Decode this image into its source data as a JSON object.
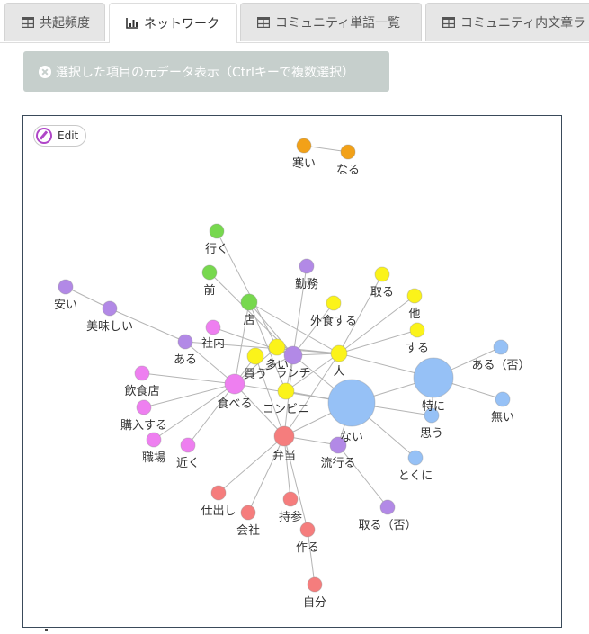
{
  "tabs": [
    {
      "label": "共起頻度",
      "icon": "table-icon",
      "active": false
    },
    {
      "label": "ネットワーク",
      "icon": "bar-chart-icon",
      "active": true
    },
    {
      "label": "コミュニティ単語一覧",
      "icon": "table-icon",
      "active": false
    },
    {
      "label": "コミュニティ内文章ラ",
      "icon": "table-icon",
      "active": false
    }
  ],
  "toolbar": {
    "show_source_label": "選択した項目の元データ表示（Ctrlキーで複数選択）",
    "show_source_icon": "close-circle-icon"
  },
  "network": {
    "edit_label": "Edit",
    "edit_icon": "pencil-circle-icon",
    "colors": {
      "orange": "#f2a118",
      "green": "#77d84e",
      "purple": "#b289e6",
      "pink": "#ee7ff0",
      "yellow": "#fbf31a",
      "blue": "#96c1f6",
      "red": "#f57d7d",
      "edge": "#b4b4b4"
    },
    "nodes": [
      {
        "label": "寒い",
        "color": "orange"
      },
      {
        "label": "なる",
        "color": "orange"
      },
      {
        "label": "行く",
        "color": "green"
      },
      {
        "label": "前",
        "color": "green"
      },
      {
        "label": "店",
        "color": "green"
      },
      {
        "label": "安い",
        "color": "purple"
      },
      {
        "label": "美味しい",
        "color": "purple"
      },
      {
        "label": "ある",
        "color": "purple"
      },
      {
        "label": "勤務",
        "color": "purple"
      },
      {
        "label": "ランチ",
        "color": "purple"
      },
      {
        "label": "流行る",
        "color": "purple"
      },
      {
        "label": "取る（否）",
        "color": "purple"
      },
      {
        "label": "社内",
        "color": "pink"
      },
      {
        "label": "飲食店",
        "color": "pink"
      },
      {
        "label": "食べる",
        "color": "pink"
      },
      {
        "label": "購入する",
        "color": "pink"
      },
      {
        "label": "職場",
        "color": "pink"
      },
      {
        "label": "近く",
        "color": "pink"
      },
      {
        "label": "取る",
        "color": "yellow"
      },
      {
        "label": "他",
        "color": "yellow"
      },
      {
        "label": "外食する",
        "color": "yellow"
      },
      {
        "label": "する",
        "color": "yellow"
      },
      {
        "label": "買う",
        "color": "yellow"
      },
      {
        "label": "多い",
        "color": "yellow"
      },
      {
        "label": "人",
        "color": "yellow"
      },
      {
        "label": "コンビニ",
        "color": "yellow"
      },
      {
        "label": "ある（否）",
        "color": "blue"
      },
      {
        "label": "特に",
        "color": "blue"
      },
      {
        "label": "無い",
        "color": "blue"
      },
      {
        "label": "思う",
        "color": "blue"
      },
      {
        "label": "ない",
        "color": "blue"
      },
      {
        "label": "とくに",
        "color": "blue"
      },
      {
        "label": "弁当",
        "color": "red"
      },
      {
        "label": "仕出し",
        "color": "red"
      },
      {
        "label": "会社",
        "color": "red"
      },
      {
        "label": "持参",
        "color": "red"
      },
      {
        "label": "作る",
        "color": "red"
      },
      {
        "label": "自分",
        "color": "red"
      }
    ],
    "edges": [
      [
        "寒い",
        "なる"
      ],
      [
        "行く",
        "多い"
      ],
      [
        "前",
        "ランチ"
      ],
      [
        "店",
        "ランチ"
      ],
      [
        "店",
        "食べる"
      ],
      [
        "店",
        "人"
      ],
      [
        "店",
        "コンビニ"
      ],
      [
        "安い",
        "美味しい"
      ],
      [
        "美味しい",
        "ある"
      ],
      [
        "ある",
        "食べる"
      ],
      [
        "ある",
        "人"
      ],
      [
        "社内",
        "ランチ"
      ],
      [
        "勤務",
        "ランチ"
      ],
      [
        "取る",
        "人"
      ],
      [
        "他",
        "人"
      ],
      [
        "外食する",
        "ランチ"
      ],
      [
        "する",
        "人"
      ],
      [
        "食べる",
        "飲食店"
      ],
      [
        "食べる",
        "購入する"
      ],
      [
        "食べる",
        "職場"
      ],
      [
        "食べる",
        "近く"
      ],
      [
        "食べる",
        "買う"
      ],
      [
        "食べる",
        "ランチ"
      ],
      [
        "食べる",
        "多い"
      ],
      [
        "食べる",
        "弁当"
      ],
      [
        "食べる",
        "ない"
      ],
      [
        "ランチ",
        "多い"
      ],
      [
        "ランチ",
        "人"
      ],
      [
        "ランチ",
        "ない"
      ],
      [
        "ランチ",
        "コンビニ"
      ],
      [
        "ランチ",
        "弁当"
      ],
      [
        "多い",
        "人"
      ],
      [
        "人",
        "特に"
      ],
      [
        "人",
        "コンビニ"
      ],
      [
        "人",
        "弁当"
      ],
      [
        "ない",
        "特に"
      ],
      [
        "ない",
        "とくに"
      ],
      [
        "ない",
        "コンビニ"
      ],
      [
        "ない",
        "流行る"
      ],
      [
        "ない",
        "弁当"
      ],
      [
        "ない",
        "思う"
      ],
      [
        "特に",
        "ある（否）"
      ],
      [
        "特に",
        "無い"
      ],
      [
        "特に",
        "思う"
      ],
      [
        "弁当",
        "仕出し"
      ],
      [
        "弁当",
        "会社"
      ],
      [
        "弁当",
        "持参"
      ],
      [
        "弁当",
        "作る"
      ],
      [
        "弁当",
        "流行る"
      ],
      [
        "弁当",
        "買う"
      ],
      [
        "作る",
        "自分"
      ],
      [
        "流行る",
        "取る（否）"
      ]
    ]
  }
}
